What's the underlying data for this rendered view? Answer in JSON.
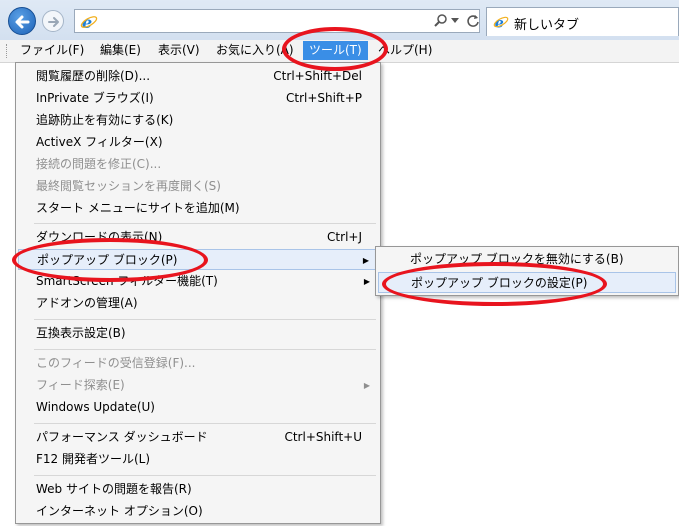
{
  "tab": {
    "title": "新しいタブ"
  },
  "address": {
    "value": ""
  },
  "menubar": [
    {
      "label": "ファイル(F)"
    },
    {
      "label": "編集(E)"
    },
    {
      "label": "表示(V)"
    },
    {
      "label": "お気に入り(A)"
    },
    {
      "label": "ツール(T)",
      "active": true
    },
    {
      "label": "ヘルプ(H)"
    }
  ],
  "tools_menu": {
    "items": [
      {
        "label": "閲覧履歴の削除(D)...",
        "shortcut": "Ctrl+Shift+Del"
      },
      {
        "label": "InPrivate ブラウズ(I)",
        "shortcut": "Ctrl+Shift+P"
      },
      {
        "label": "追跡防止を有効にする(K)",
        "shortcut": ""
      },
      {
        "label": "ActiveX フィルター(X)",
        "shortcut": ""
      },
      {
        "label": "接続の問題を修正(C)...",
        "shortcut": "",
        "disabled": true
      },
      {
        "label": "最終閲覧セッションを再度開く(S)",
        "shortcut": "",
        "disabled": true
      },
      {
        "label": "スタート メニューにサイトを追加(M)",
        "shortcut": ""
      },
      {
        "label": "ダウンロードの表示(N)",
        "shortcut": "Ctrl+J"
      },
      {
        "label": "ポップアップ ブロック(P)",
        "shortcut": "",
        "submenu": true
      },
      {
        "label": "SmartScreen フィルター機能(T)",
        "shortcut": "",
        "submenu": true
      },
      {
        "label": "アドオンの管理(A)",
        "shortcut": ""
      },
      {
        "label": "互換表示設定(B)",
        "shortcut": ""
      },
      {
        "label": "このフィードの受信登録(F)...",
        "shortcut": "",
        "disabled": true
      },
      {
        "label": "フィード探索(E)",
        "shortcut": "",
        "disabled": true,
        "submenu": true
      },
      {
        "label": "Windows Update(U)",
        "shortcut": ""
      },
      {
        "label": "パフォーマンス ダッシュボード",
        "shortcut": "Ctrl+Shift+U"
      },
      {
        "label": "F12 開発者ツール(L)",
        "shortcut": ""
      },
      {
        "label": "Web サイトの問題を報告(R)",
        "shortcut": ""
      },
      {
        "label": "インターネット オプション(O)",
        "shortcut": ""
      }
    ]
  },
  "popup_submenu": {
    "items": [
      {
        "label": "ポップアップ ブロックを無効にする(B)"
      },
      {
        "label": "ポップアップ ブロックの設定(P)"
      }
    ]
  },
  "colors": {
    "highlight": "#3a8ee6",
    "annotation": "#e8141e"
  }
}
